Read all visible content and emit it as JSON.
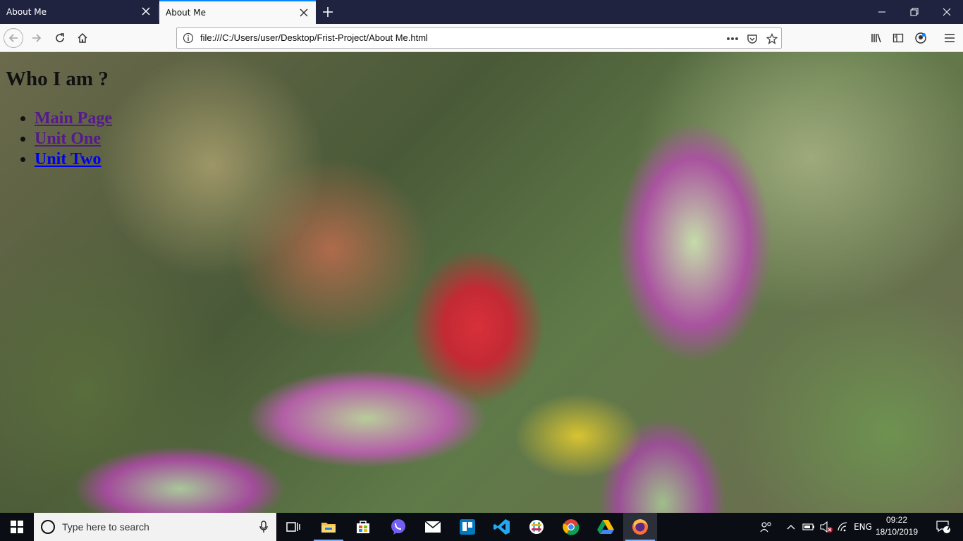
{
  "browser": {
    "tabs": [
      {
        "title": "About Me",
        "active": false
      },
      {
        "title": "About Me",
        "active": true
      }
    ],
    "url": "file:///C:/Users/user/Desktop/Frist-Project/About Me.html",
    "accent_color": "#0a84ff",
    "tabstrip_color": "#202340"
  },
  "page": {
    "heading": "Who I am ?",
    "links": [
      {
        "label": "Main Page",
        "visited": true
      },
      {
        "label": "Unit One",
        "visited": true
      },
      {
        "label": "Unit Two",
        "visited": false
      }
    ],
    "background": "blurred photo of a red flower bud with green and purple leaves"
  },
  "taskbar": {
    "search_placeholder": "Type here to search",
    "pinned_apps": [
      "task-view",
      "file-explorer",
      "microsoft-store",
      "viber",
      "mail",
      "trello",
      "vs-code",
      "slack",
      "chrome",
      "google-drive",
      "firefox"
    ],
    "language": "ENG",
    "time": "09:22",
    "date": "18/10/2019",
    "notification_count": "7"
  }
}
